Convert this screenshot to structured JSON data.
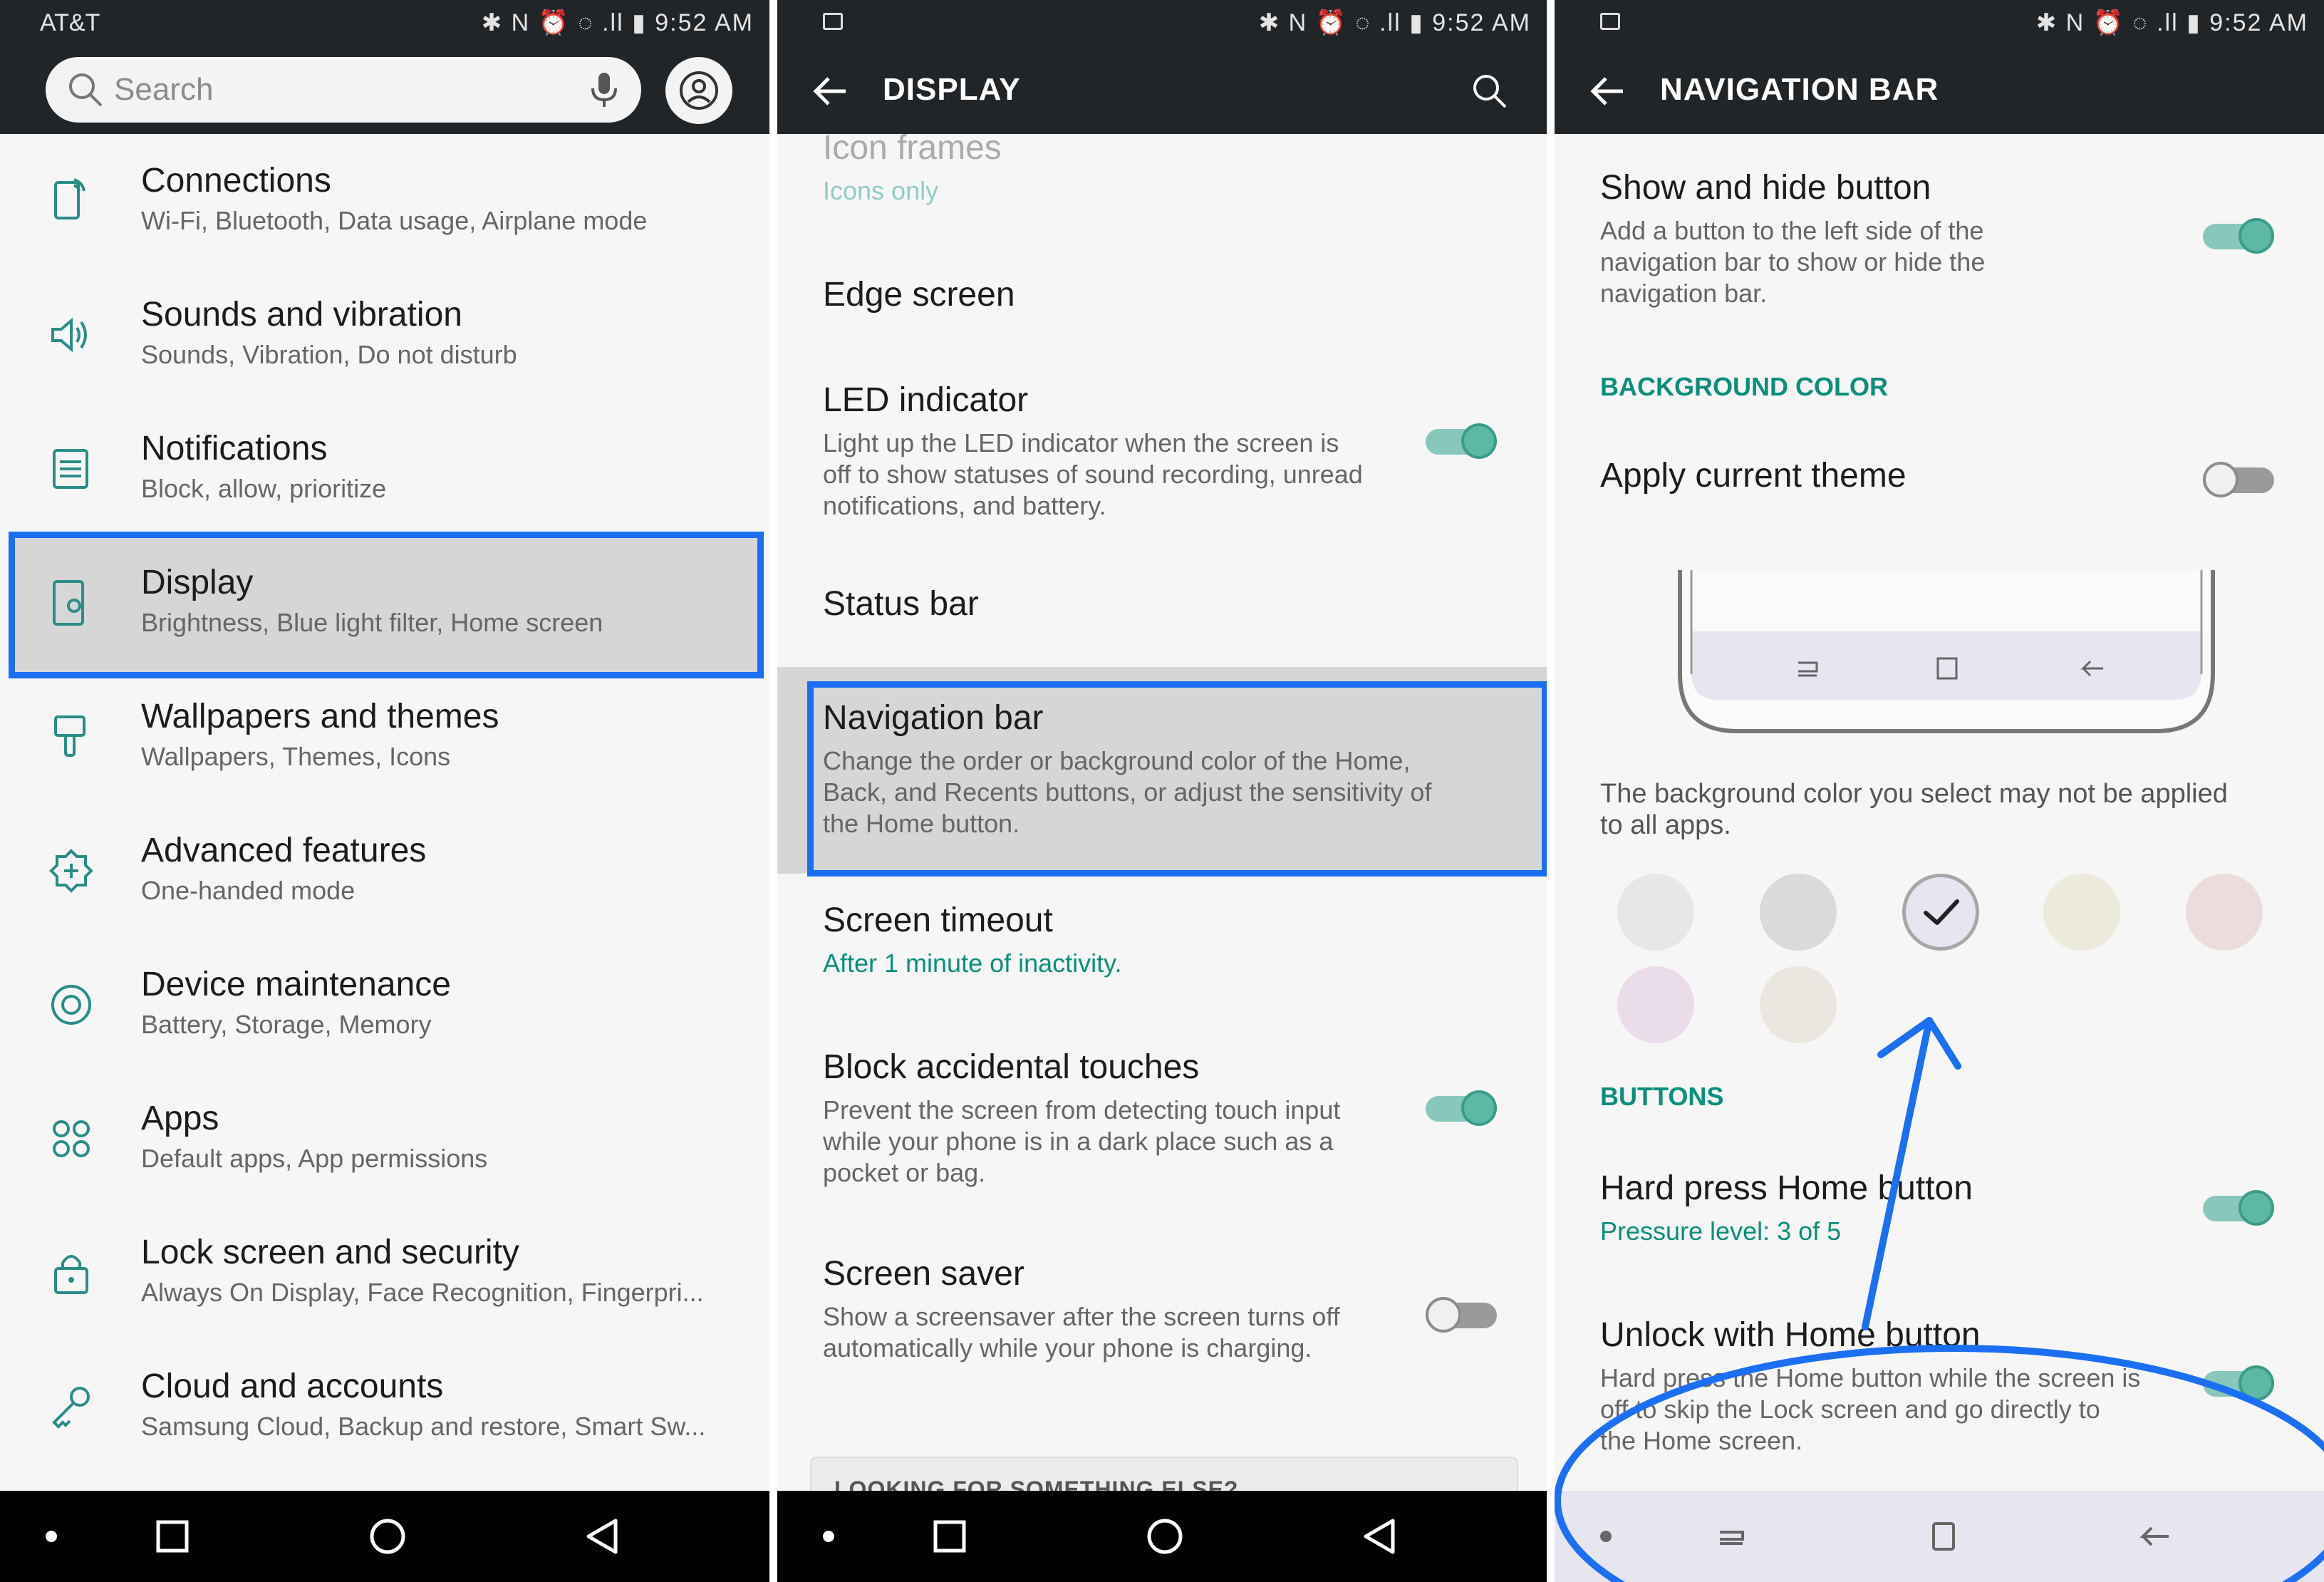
{
  "status_bar": {
    "carrier": "AT&T",
    "icons": "✱ N ⏰ ◌ .ll ▮",
    "time": "9:52 AM"
  },
  "panel1": {
    "search_placeholder": "Search",
    "items": [
      {
        "title": "Connections",
        "subtitle": "Wi-Fi, Bluetooth, Data usage, Airplane mode",
        "icon": "connections-icon"
      },
      {
        "title": "Sounds and vibration",
        "subtitle": "Sounds, Vibration, Do not disturb",
        "icon": "speaker-icon"
      },
      {
        "title": "Notifications",
        "subtitle": "Block, allow, prioritize",
        "icon": "notifications-icon"
      },
      {
        "title": "Display",
        "subtitle": "Brightness, Blue light filter, Home screen",
        "icon": "display-icon",
        "highlighted": true
      },
      {
        "title": "Wallpapers and themes",
        "subtitle": "Wallpapers, Themes, Icons",
        "icon": "paintbrush-icon"
      },
      {
        "title": "Advanced features",
        "subtitle": "One-handed mode",
        "icon": "gear-plus-icon"
      },
      {
        "title": "Device maintenance",
        "subtitle": "Battery, Storage, Memory",
        "icon": "maintenance-icon"
      },
      {
        "title": "Apps",
        "subtitle": "Default apps, App permissions",
        "icon": "apps-grid-icon"
      },
      {
        "title": "Lock screen and security",
        "subtitle": "Always On Display, Face Recognition, Fingerpri...",
        "icon": "lock-icon"
      },
      {
        "title": "Cloud and accounts",
        "subtitle": "Samsung Cloud, Backup and restore, Smart Sw...",
        "icon": "key-icon"
      }
    ]
  },
  "panel2": {
    "title": "DISPLAY",
    "items": [
      {
        "title": "Icon frames",
        "subtitle": "Icons only"
      },
      {
        "title": "Edge screen"
      },
      {
        "title": "LED indicator",
        "subtitle": "Light up the LED indicator when the screen is off to show statuses of sound recording, unread notifications, and battery.",
        "toggle": true
      },
      {
        "title": "Status bar"
      },
      {
        "title": "Navigation bar",
        "subtitle": "Change the order or background color of the Home, Back, and Recents buttons, or adjust the sensitivity of the Home button.",
        "highlighted": true
      },
      {
        "title": "Screen timeout",
        "subtitle": "After 1 minute of inactivity."
      },
      {
        "title": "Block accidental touches",
        "subtitle": "Prevent the screen from detecting touch input while your phone is in a dark place such as a pocket or bag.",
        "toggle": true
      },
      {
        "title": "Screen saver",
        "subtitle": "Show a screensaver after the screen turns off automatically while your phone is charging.",
        "toggle": false
      }
    ],
    "footer_card": "LOOKING FOR SOMETHING ELSE?"
  },
  "panel3": {
    "title": "NAVIGATION BAR",
    "show_hide": {
      "title": "Show and hide button",
      "subtitle": "Add a button to the left side of the navigation bar to show or hide the navigation bar.",
      "toggle": true
    },
    "section_bg": "BACKGROUND COLOR",
    "apply_theme": {
      "title": "Apply current theme",
      "toggle": false
    },
    "bg_note": "The background color you select may not be applied to all apps.",
    "swatches": [
      "#e7e7e7",
      "#dadada",
      "#e6e5f0",
      "#ecebdc",
      "#eddcdc",
      "#ebdcea",
      "#ebe6df"
    ],
    "selected_swatch_index": 2,
    "section_buttons": "BUTTONS",
    "hard_press": {
      "title": "Hard press Home button",
      "subtitle": "Pressure level: 3 of 5",
      "toggle": true
    },
    "unlock": {
      "title": "Unlock with Home button",
      "subtitle": "Hard press the Home button while the screen is off to skip the Lock screen and go directly to the Home screen.",
      "toggle": true
    },
    "navbar_color": "#e6e5f0"
  },
  "colors": {
    "accent_blue": "#1c6ff2",
    "teal": "#0b8f7c",
    "bar": "#222528"
  }
}
